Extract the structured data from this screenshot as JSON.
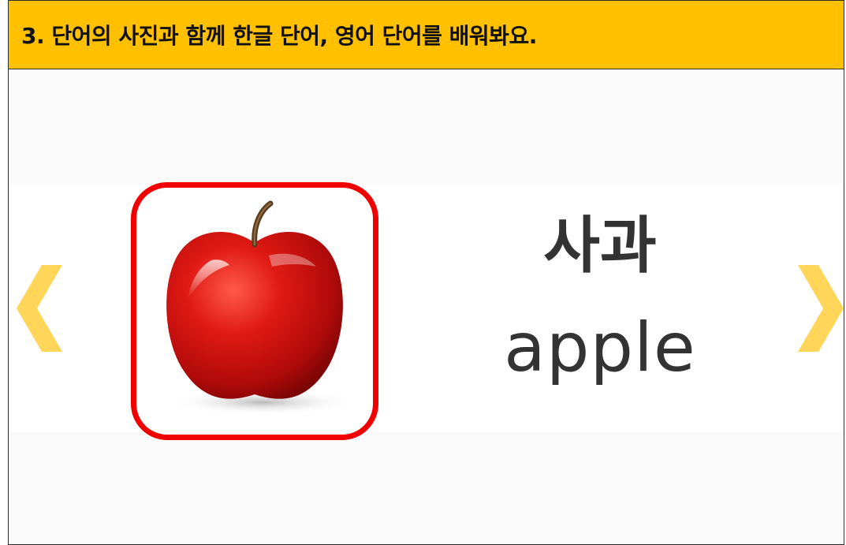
{
  "header": {
    "title": "3. 단어의 사진과 함께 한글 단어, 영어 단어를 배워봐요."
  },
  "card": {
    "word_korean": "사과",
    "word_english": "apple",
    "photo_subject": "apple"
  },
  "navigation": {
    "prev_icon": "chevron-left-icon",
    "next_icon": "chevron-right-icon"
  },
  "colors": {
    "header_bg": "#FFC000",
    "frame_border": "#F00000",
    "arrow": "#FFD55A",
    "text": "#333333"
  }
}
